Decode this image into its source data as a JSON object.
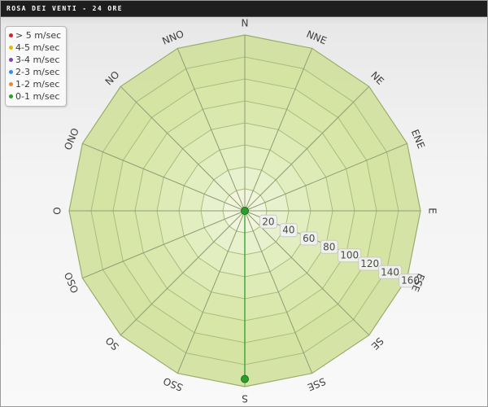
{
  "window": {
    "title": "ROSA DEI VENTI - 24 ORE"
  },
  "legend": {
    "items": [
      {
        "label": "> 5 m/sec",
        "color": "#e02020"
      },
      {
        "label": "4-5 m/sec",
        "color": "#e8b800"
      },
      {
        "label": "3-4 m/sec",
        "color": "#8a3ec0"
      },
      {
        "label": "2-3 m/sec",
        "color": "#2e8ef0"
      },
      {
        "label": "1-2 m/sec",
        "color": "#f08a20"
      },
      {
        "label": "0-1 m/sec",
        "color": "#2aa02a"
      }
    ]
  },
  "chart_data": {
    "type": "radar",
    "directions": [
      "N",
      "NNE",
      "NE",
      "ENE",
      "E",
      "ESE",
      "SE",
      "SSE",
      "S",
      "SSO",
      "SO",
      "OSO",
      "O",
      "ONO",
      "NO",
      "NNO"
    ],
    "radial_ticks": [
      "20",
      "40",
      "60",
      "80",
      "100",
      "120",
      "140",
      "160"
    ],
    "rmax": 160,
    "grid": true,
    "legend_position": "top-left",
    "series": [
      {
        "name": "0-1 m/sec",
        "color": "#2aa02a",
        "values": [
          0,
          0,
          0,
          0,
          0,
          0,
          0,
          0,
          153,
          0,
          0,
          0,
          0,
          0,
          0,
          0
        ]
      },
      {
        "name": "1-2 m/sec",
        "color": "#f08a20",
        "values": [
          0,
          0,
          0,
          0,
          0,
          0,
          0,
          0,
          0,
          0,
          0,
          0,
          0,
          0,
          0,
          0
        ]
      },
      {
        "name": "2-3 m/sec",
        "color": "#2e8ef0",
        "values": [
          0,
          0,
          0,
          0,
          0,
          0,
          0,
          0,
          0,
          0,
          0,
          0,
          0,
          0,
          0,
          0
        ]
      },
      {
        "name": "3-4 m/sec",
        "color": "#8a3ec0",
        "values": [
          0,
          0,
          0,
          0,
          0,
          0,
          0,
          0,
          0,
          0,
          0,
          0,
          0,
          0,
          0,
          0
        ]
      },
      {
        "name": "4-5 m/sec",
        "color": "#e8b800",
        "values": [
          0,
          0,
          0,
          0,
          0,
          0,
          0,
          0,
          0,
          0,
          0,
          0,
          0,
          0,
          0,
          0
        ]
      },
      {
        "name": "> 5 m/sec",
        "color": "#e02020",
        "values": [
          0,
          0,
          0,
          0,
          0,
          0,
          0,
          0,
          0,
          0,
          0,
          0,
          0,
          0,
          0,
          0
        ]
      }
    ]
  }
}
